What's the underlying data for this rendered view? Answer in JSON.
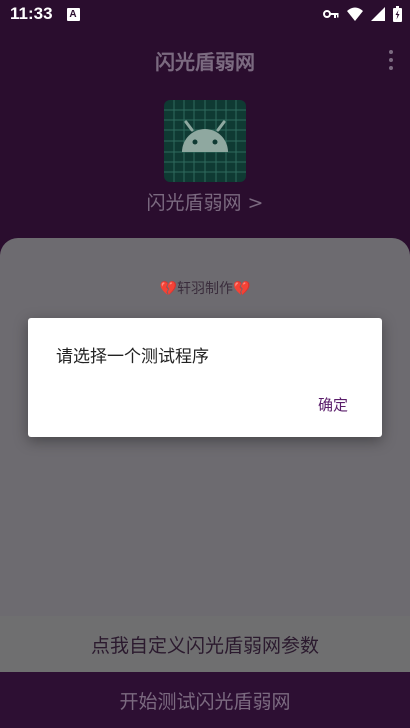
{
  "status_bar": {
    "time": "11:33",
    "notif_letter": "A"
  },
  "app_bar": {
    "title": "闪光盾弱网"
  },
  "header": {
    "app_name": "闪光盾弱网 >"
  },
  "panel": {
    "heart_left": "💔",
    "credit": "轩羽制作",
    "heart_right": "💔"
  },
  "buttons": {
    "custom": "点我自定义闪光盾弱网参数",
    "start": "开始测试闪光盾弱网"
  },
  "dialog": {
    "message": "请选择一个测试程序",
    "ok": "确定"
  },
  "icons": {
    "status": [
      "key-icon",
      "wifi-icon",
      "signal-icon",
      "battery-icon"
    ],
    "app": "android-icon",
    "menu": "overflow-menu-icon"
  },
  "colors": {
    "background": "#2a0d2e",
    "accent": "#5a1d6a",
    "app_icon_bg": "#0f3a33"
  }
}
